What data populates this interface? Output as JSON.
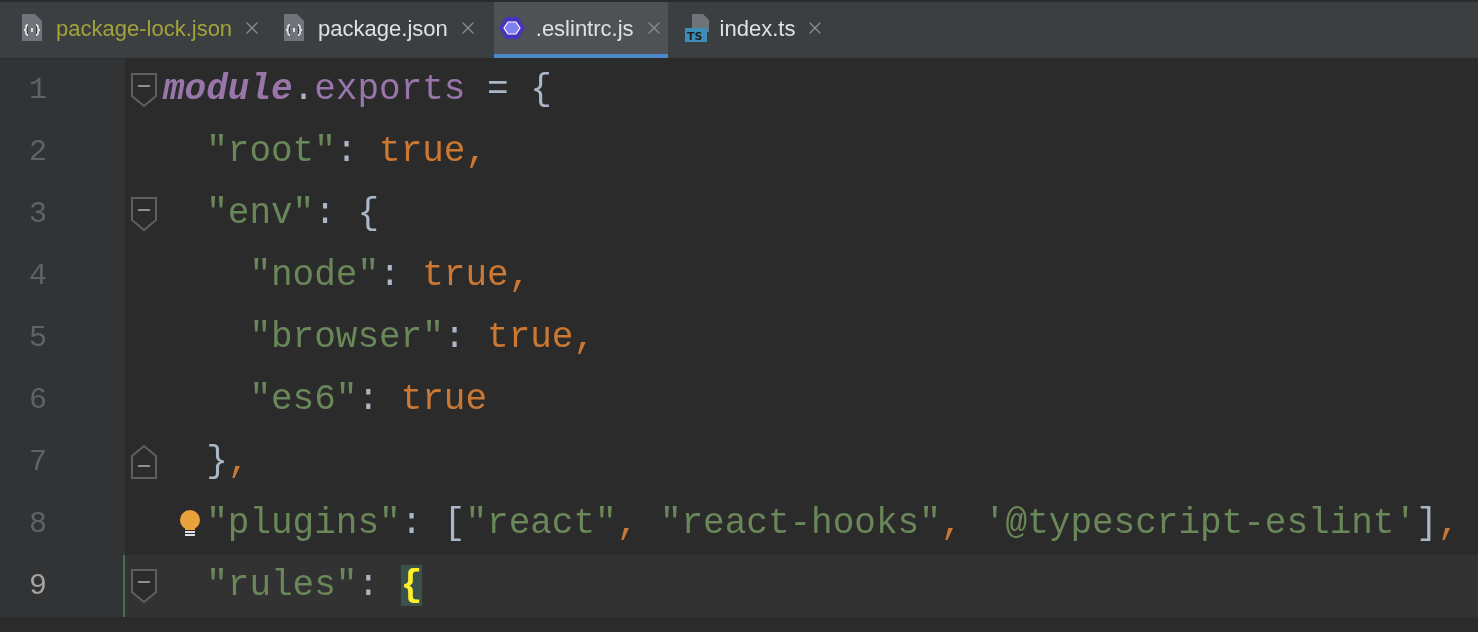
{
  "tabs": [
    {
      "label": "package-lock.json",
      "kind": "json",
      "selected": false,
      "color": "#a3a33a"
    },
    {
      "label": "package.json",
      "kind": "json",
      "selected": false,
      "color": "#dfe1e5"
    },
    {
      "label": ".eslintrc.js",
      "kind": "eslint",
      "selected": true,
      "color": "#dfe1e5"
    },
    {
      "label": "index.ts",
      "kind": "ts",
      "icon_text": "TS",
      "selected": false,
      "color": "#dfe1e5"
    }
  ],
  "editor": {
    "lines": [
      {
        "number": "1",
        "kind": "fold-start",
        "current": false,
        "hint": false,
        "tokens": [
          {
            "kind": "keyword",
            "text": "module"
          },
          {
            "kind": "punct",
            "text": "."
          },
          {
            "kind": "property",
            "text": "exports"
          },
          {
            "kind": "punct",
            "text": " = {"
          }
        ]
      },
      {
        "number": "2",
        "kind": "plain",
        "current": false,
        "hint": false,
        "tokens": [
          {
            "kind": "string",
            "text": "  \"root\""
          },
          {
            "kind": "punct",
            "text": ": "
          },
          {
            "kind": "literal",
            "text": "true,"
          }
        ]
      },
      {
        "number": "3",
        "kind": "fold-start",
        "current": false,
        "hint": false,
        "tokens": [
          {
            "kind": "string",
            "text": "  \"env\""
          },
          {
            "kind": "punct",
            "text": ": {"
          }
        ]
      },
      {
        "number": "4",
        "kind": "plain",
        "current": false,
        "hint": false,
        "tokens": [
          {
            "kind": "string",
            "text": "    \"node\""
          },
          {
            "kind": "punct",
            "text": ": "
          },
          {
            "kind": "literal",
            "text": "true,"
          }
        ]
      },
      {
        "number": "5",
        "kind": "plain",
        "current": false,
        "hint": false,
        "tokens": [
          {
            "kind": "string",
            "text": "    \"browser\""
          },
          {
            "kind": "punct",
            "text": ": "
          },
          {
            "kind": "literal",
            "text": "true,"
          }
        ]
      },
      {
        "number": "6",
        "kind": "plain",
        "current": false,
        "hint": false,
        "tokens": [
          {
            "kind": "string",
            "text": "    \"es6\""
          },
          {
            "kind": "punct",
            "text": ": "
          },
          {
            "kind": "literal",
            "text": "true"
          }
        ]
      },
      {
        "number": "7",
        "kind": "fold-end",
        "current": false,
        "hint": false,
        "tokens": [
          {
            "kind": "punct",
            "text": "  }"
          },
          {
            "kind": "literal",
            "text": ","
          }
        ]
      },
      {
        "number": "8",
        "kind": "plain",
        "current": false,
        "hint": true,
        "tokens": [
          {
            "kind": "string",
            "text": "  \"plugins\""
          },
          {
            "kind": "punct",
            "text": ": ["
          },
          {
            "kind": "string",
            "text": "\"react\""
          },
          {
            "kind": "literal",
            "text": ", "
          },
          {
            "kind": "string",
            "text": "\"react-hooks\""
          },
          {
            "kind": "literal",
            "text": ", "
          },
          {
            "kind": "string",
            "text": "'@typescript-eslint'"
          },
          {
            "kind": "punct",
            "text": "]"
          },
          {
            "kind": "literal",
            "text": ","
          }
        ]
      },
      {
        "number": "9",
        "kind": "fold-start",
        "current": true,
        "hint": false,
        "tokens": [
          {
            "kind": "string",
            "text": "  \"rules\""
          },
          {
            "kind": "punct",
            "text": ": "
          },
          {
            "kind": "match",
            "text": "{"
          }
        ]
      }
    ]
  }
}
